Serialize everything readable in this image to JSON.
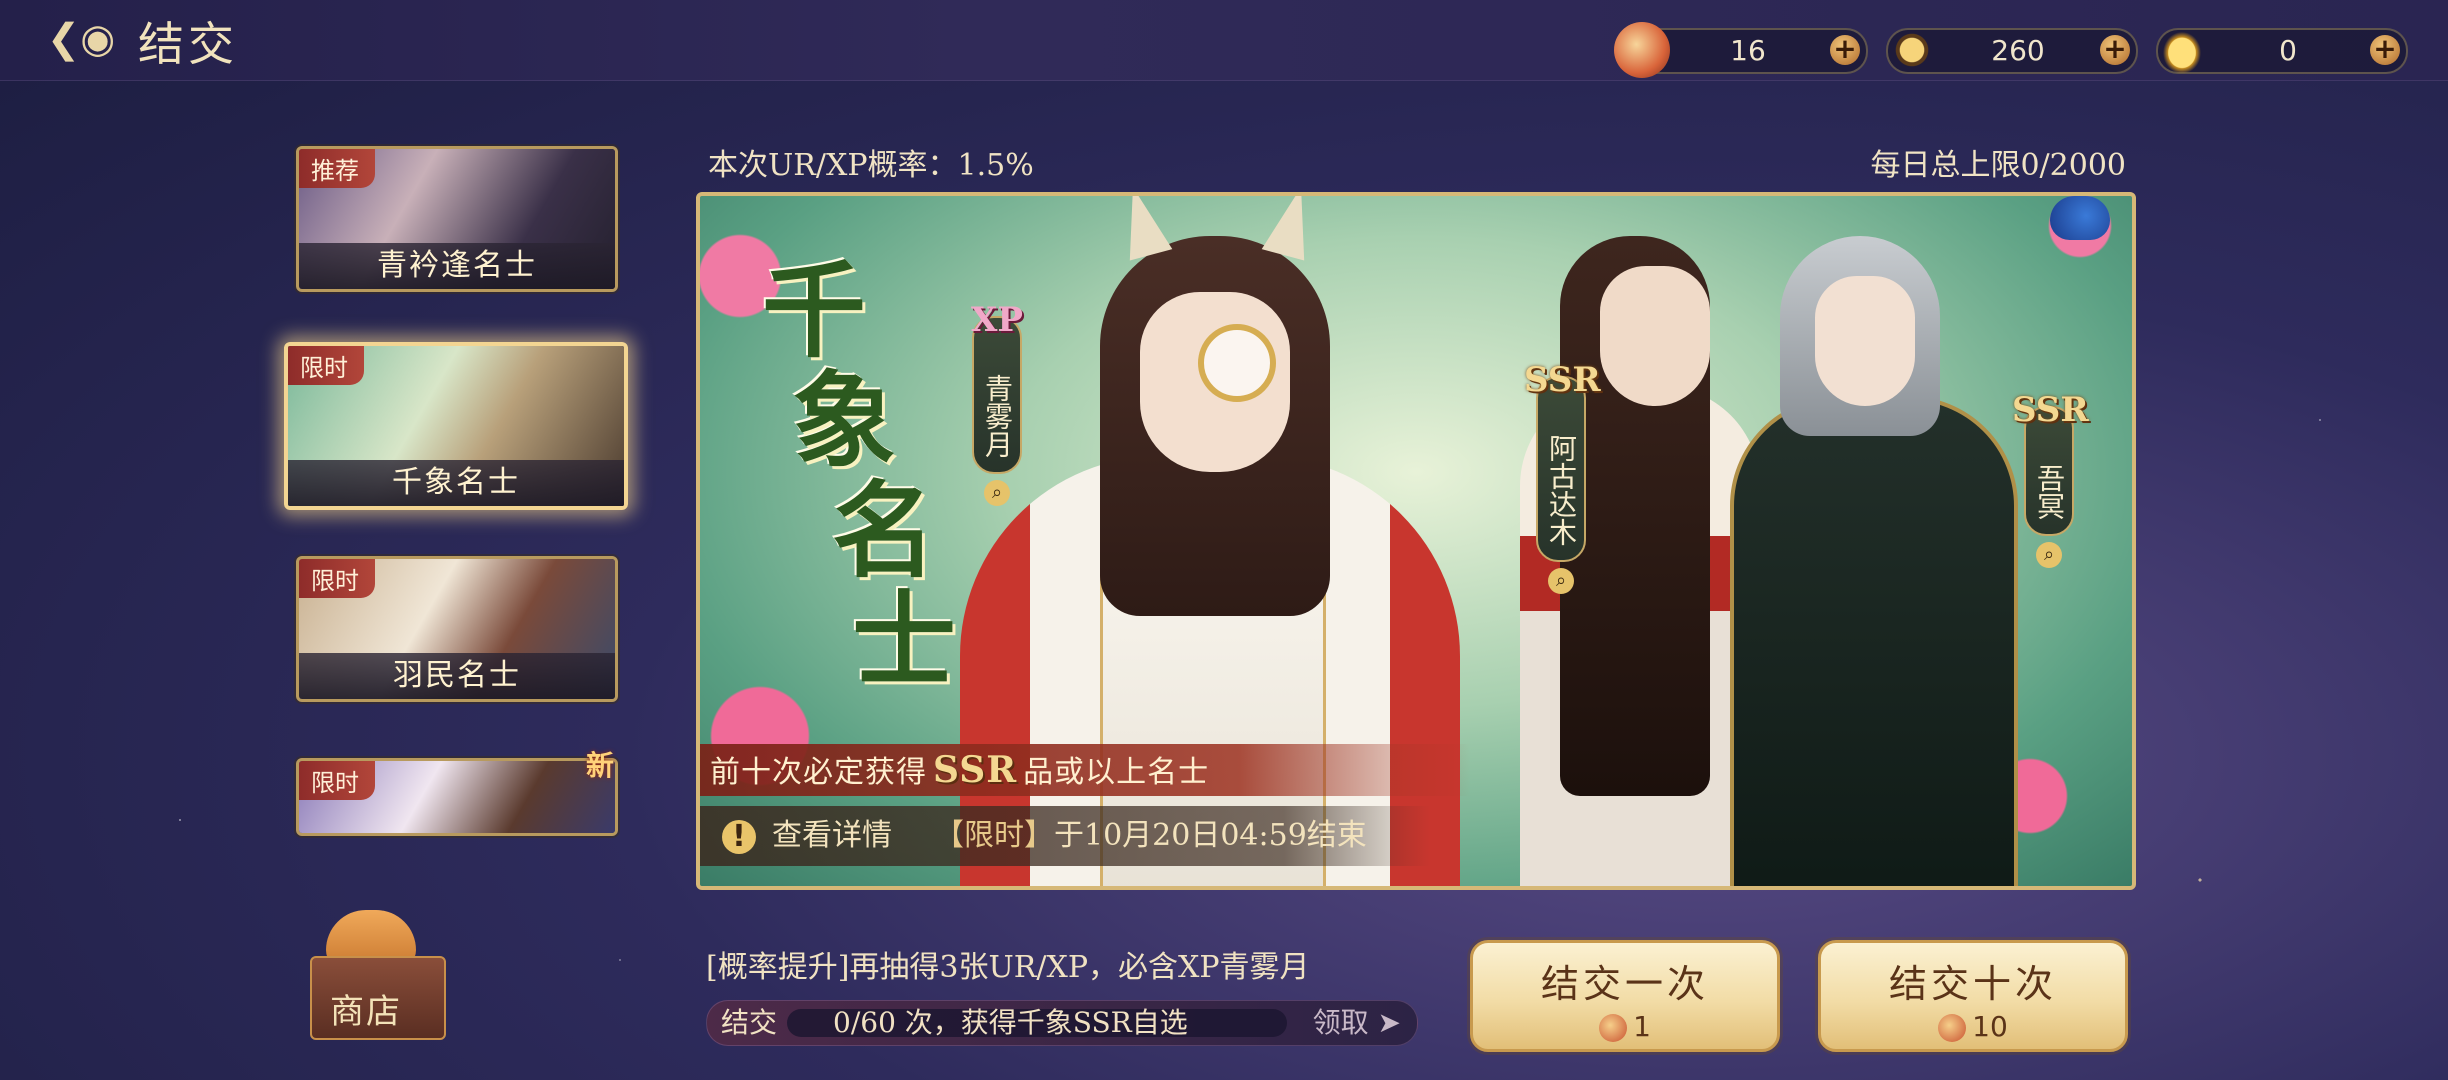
{
  "header": {
    "title": "结交",
    "back_icon": "cloud-back-icon"
  },
  "currencies": [
    {
      "name": "pull-ticket",
      "icon": "ticket-icon",
      "value": "16",
      "color": "#d9643a"
    },
    {
      "name": "feather",
      "icon": "feather-icon",
      "value": "260",
      "color": "#e5b64a"
    },
    {
      "name": "gold-ingot",
      "icon": "ingot-icon",
      "value": "0",
      "color": "#f0c94e"
    }
  ],
  "sidebar": {
    "items": [
      {
        "tag": "推荐",
        "label": "青衿逢名士",
        "active": false
      },
      {
        "tag": "限时",
        "label": "千象名士",
        "active": true
      },
      {
        "tag": "限时",
        "label": "羽民名士",
        "active": false
      },
      {
        "tag": "限时",
        "label": "",
        "active": false,
        "badge": "新"
      }
    ]
  },
  "banner": {
    "rate_text": "本次UR/XP概率：1.5%",
    "daily_limit": "每日总上限0/2000",
    "big_name": [
      "千",
      "象",
      "名",
      "士"
    ],
    "characters": [
      {
        "rarity": "XP",
        "name": "青雾月"
      },
      {
        "rarity": "SSR",
        "name": "阿古达木"
      },
      {
        "rarity": "SSR",
        "name": "吾冥"
      }
    ],
    "guarantee_pre": "前十次必定获得",
    "guarantee_ssr": "SSR",
    "guarantee_post": "品或以上名士",
    "details_label": "查看详情",
    "time_tag": "【限时】",
    "end_text": "于10月20日04:59结束"
  },
  "shop": {
    "label": "商店"
  },
  "footer": {
    "boost_text": "[概率提升]再抽得3张UR/XP，必含XP青雾月",
    "progress_label": "结交",
    "progress_text": "0/60 次，获得千象SSR自选",
    "progress_value": 0,
    "claim_label": "领取",
    "pull_once": {
      "label": "结交一次",
      "cost": "1"
    },
    "pull_ten": {
      "label": "结交十次",
      "cost": "10"
    }
  }
}
